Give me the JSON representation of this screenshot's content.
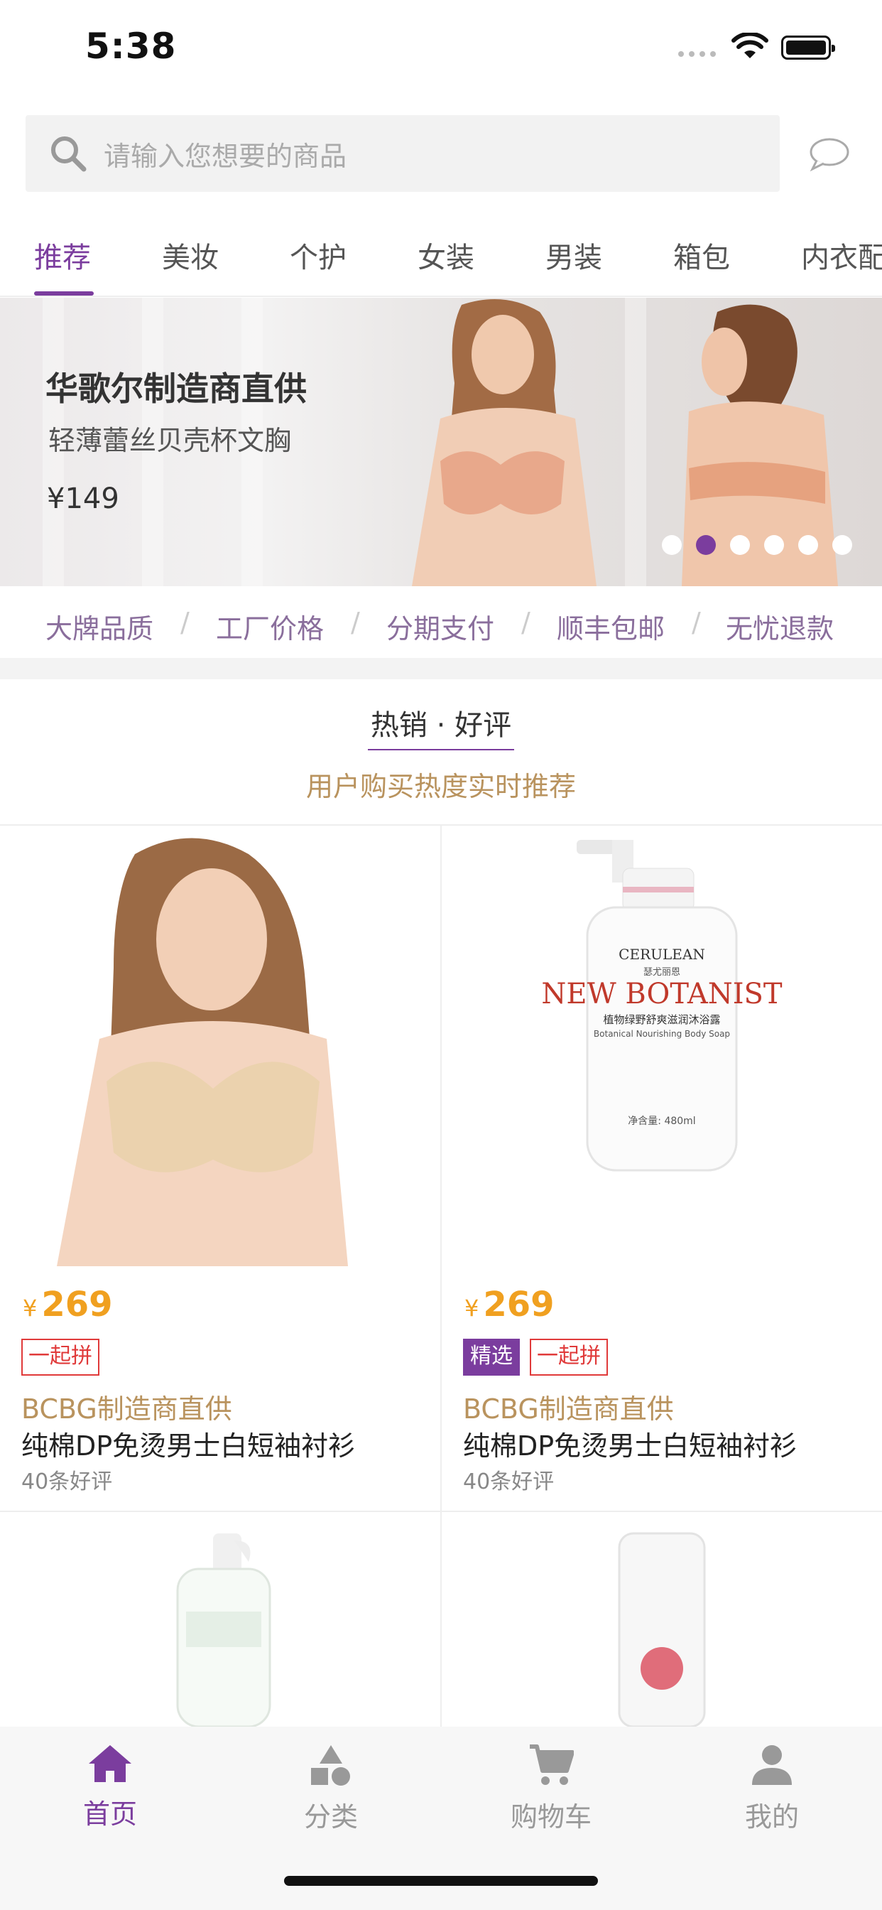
{
  "status_bar": {
    "time": "5:38"
  },
  "search": {
    "placeholder": "请输入您想要的商品"
  },
  "tabs": [
    {
      "label": "推荐",
      "active": true
    },
    {
      "label": "美妆"
    },
    {
      "label": "个护"
    },
    {
      "label": "女装"
    },
    {
      "label": "男装"
    },
    {
      "label": "箱包"
    },
    {
      "label": "内衣配"
    }
  ],
  "banner": {
    "title": "华歌尔制造商直供",
    "subtitle": "轻薄蕾丝贝壳杯文胸",
    "price": "¥149",
    "dot_count": 6,
    "active_dot": 1
  },
  "features": [
    "大牌品质",
    "工厂价格",
    "分期支付",
    "顺丰包邮",
    "无忧退款"
  ],
  "feature_separator": "/",
  "section": {
    "title": "热销 · 好评",
    "subtitle": "用户购买热度实时推荐"
  },
  "products": [
    {
      "currency": "¥",
      "price": "269",
      "badges": [
        "一起拼"
      ],
      "brand": "BCBG制造商直供",
      "name": "纯棉DP免烫男士白短袖衬衫",
      "reviews": "40条好评"
    },
    {
      "currency": "¥",
      "price": "269",
      "badges": [
        "精选",
        "一起拼"
      ],
      "brand": "BCBG制造商直供",
      "name": "纯棉DP免烫男士白短袖衬衫",
      "reviews": "40条好评"
    }
  ],
  "product_bottle": {
    "brand": "CERULEAN",
    "brand_cn": "瑟尤丽恩",
    "product": "NEW BOTANIST",
    "desc_cn": "植物绿野舒爽滋润沐浴露",
    "desc_en": "Botanical Nourishing Body Soap",
    "volume": "净含量: 480ml"
  },
  "bottom_nav": [
    {
      "label": "首页",
      "icon": "home-icon",
      "active": true
    },
    {
      "label": "分类",
      "icon": "category-icon"
    },
    {
      "label": "购物车",
      "icon": "cart-icon"
    },
    {
      "label": "我的",
      "icon": "user-icon"
    }
  ],
  "colors": {
    "accent": "#7b3d9e",
    "price": "#f0a020",
    "brand": "#b9935e",
    "badge_red": "#e03a3a"
  }
}
